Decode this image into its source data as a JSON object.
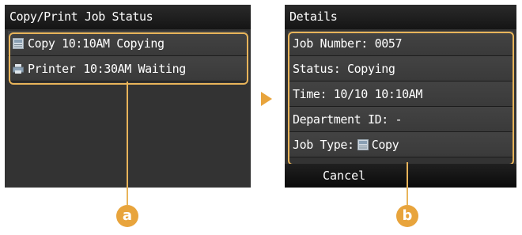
{
  "left_screen": {
    "title": "Copy/Print Job Status",
    "jobs": [
      {
        "type": "Copy",
        "time": "10:10AM",
        "status": "Copying",
        "icon": "copy-job-icon"
      },
      {
        "type": "Printer",
        "time": "10:30AM",
        "status": "Waiting",
        "icon": "printer-job-icon"
      }
    ]
  },
  "right_screen": {
    "title": "Details",
    "rows": {
      "job_number": "Job Number: 0057",
      "status": "Status: Copying",
      "time": "Time: 10/10 10:10AM",
      "department": "Department ID: -",
      "job_type_label": "Job Type:",
      "job_type_value": "Copy"
    },
    "cancel_label": "Cancel"
  },
  "callouts": {
    "a": "a",
    "b": "b"
  },
  "colors": {
    "screen_bg": "#333333",
    "highlight": "#e8b45a",
    "badge": "#e8a43c"
  }
}
